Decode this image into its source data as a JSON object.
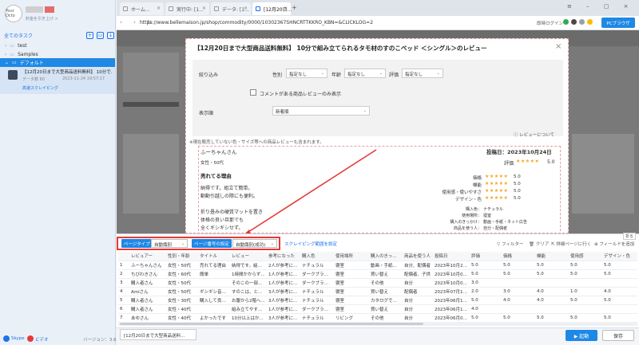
{
  "sidebar": {
    "avatar_text": "Your Octo",
    "plan_text": "料金を引き上げ >",
    "all_tasks": "全てのタスク",
    "tree": [
      {
        "label": "test"
      },
      {
        "label": "Samples"
      },
      {
        "label": "デフォルト"
      }
    ],
    "task": {
      "title": "【12月20日まで大型商品送料無料】 10分で...",
      "meta_label": "データ数",
      "meta_count": "60",
      "meta_date": "2023-11-24 19:57:17",
      "link": "高速スクレイピング"
    },
    "footer": {
      "skype": "Skype",
      "video": "ビデオ",
      "version": "バージョン：3.6.4"
    }
  },
  "tabs": [
    {
      "label": "ホーム..."
    },
    {
      "label": "実行中: [1..."
    },
    {
      "label": "データ: [1..."
    },
    {
      "label": "[12月20日..."
    }
  ],
  "address": {
    "url": "https://www.bellemaison.jp/shop/commodity/0000/10302367SHNCRTTKKRO_KBN=&CLICKLOG=2",
    "login": "即時ログイン",
    "pc_browser": "PCブラウザ"
  },
  "modal": {
    "title": "【12月20日まで大型商品送料無料】 10分で組み立てられるタモ材のすのこベッド ＜シングル＞のレビュー",
    "filter": {
      "narrow_label": "絞り込み",
      "sex_label": "性別",
      "sex_value": "指定なし",
      "age_label": "年齢",
      "age_value": "指定なし",
      "rating_label": "評価",
      "rating_value": "指定なし",
      "comment_only": "コメントがある商品レビューのみ表示",
      "order_label": "表示順",
      "order_value": "新着順"
    },
    "review_about": "ⓘ レビューについて",
    "note": "※現在販売していない色・サイズ等への商品レビューも含まれます。",
    "review": {
      "name": "ふーちゃんさん",
      "post_date": "投稿日：2023年10月24日",
      "attr": "女性・50代",
      "overall_label": "評価",
      "overall_stars": "★★★★★",
      "overall_score": "5.0",
      "reason_title": "売れてる理由",
      "body": [
        "納得です。組立て簡単。",
        "動動引越しの際にも便利。",
        "",
        "折り畳みの硬質マットを置き",
        "体格の良い旦那でも",
        "全くギシギシせず。"
      ],
      "ratings": [
        {
          "label": "価格",
          "stars": "★★★★★",
          "value": "5.0"
        },
        {
          "label": "機能",
          "stars": "★★★★★",
          "value": "5.0"
        },
        {
          "label": "使用感・使いやすさ",
          "stars": "★★★★★",
          "value": "5.0"
        },
        {
          "label": "デザイン・色",
          "stars": "★★★★★",
          "value": "5.0"
        }
      ],
      "attrs": [
        {
          "label": "購入色：",
          "value": "ナチュラル"
        },
        {
          "label": "使用場所：",
          "value": "寝室"
        },
        {
          "label": "購入のきっかけ：",
          "value": "動画・手紙・ネット広告"
        },
        {
          "label": "商品を使う人：",
          "value": "自分・配偶者"
        }
      ]
    }
  },
  "toolbar": {
    "page_type_label": "ページタイプ",
    "page_type_value": "自動識別",
    "page_num_label": "ページ番号の設定",
    "page_num_value": "自動識別(成功)",
    "scroll_settings": "スクレイピング範囲を設定",
    "filter": "フィルター",
    "clear": "クリア",
    "detail_page": "詳細ページに行く",
    "add_field": "フィールドを追加",
    "fold": "折る"
  },
  "table": {
    "headers": [
      "",
      "レビュアー",
      "性別・年齢",
      "タイトル",
      "レビュー",
      "参考になった",
      "購入色",
      "使用場所",
      "購入のきっかけ",
      "商品を使う人",
      "投稿日",
      "評価",
      "価格",
      "機能",
      "使用感",
      "デザイン・色"
    ],
    "rows": [
      [
        "1",
        "ふーちゃんさん",
        "女性・50代",
        "売れてる理由",
        "納得です。組立...",
        "2人が参考になっ...",
        "ナチュラル",
        "寝室",
        "動画・手紙...",
        "自分、配偶者",
        "2023年10月24...",
        "5.0",
        "5.0",
        "5.0",
        "5.0",
        "5.0"
      ],
      [
        "2",
        "ちびわきさん",
        "女性・60代",
        "簡単",
        "1時間かからず...",
        "1人が参考になっ...",
        "ダークブラウン",
        "寝室",
        "買い替え",
        "配偶者、子供",
        "2023年10月07...",
        "5.0",
        "5.0",
        "5.0",
        "5.0",
        "5.0"
      ],
      [
        "3",
        "購入者さん",
        "女性・50代",
        "",
        "そのこの一部に...",
        "1人が参考になっ...",
        "ダークブラウン",
        "寝室",
        "その他",
        "自分",
        "2023年10月04...",
        "3.0",
        "",
        "",
        "",
        ""
      ],
      [
        "4",
        "Amiさん",
        "女性・50代",
        "ギシギシ音が...",
        "すのこは、とて...",
        "3人が参考になっ...",
        "ナチュラル",
        "寝室",
        "買い替え",
        "配偶者",
        "2023年07月12...",
        "2.0",
        "3.0",
        "4.0",
        "1.0",
        "4.0"
      ],
      [
        "5",
        "購入者さん",
        "女性・30代",
        "購入して良かっ...",
        "お腹から2階へ...",
        "3人が参考になっ...",
        "ナチュラル",
        "寝室",
        "カタログで見て",
        "自分",
        "2023年06月17...",
        "5.0",
        "4.0",
        "4.0",
        "5.0",
        "5.0"
      ],
      [
        "6",
        "購入者さん",
        "女性・40代",
        "",
        "組み立てやすく...",
        "1人が参考になっ...",
        "ダークブラウン",
        "寝室",
        "買い替え",
        "自分",
        "2023年06月11...",
        "4.0",
        "",
        "",
        "",
        ""
      ],
      [
        "7",
        "あゆさん",
        "女性・40代",
        "よかったです",
        "10分以上はか...",
        "3人が参考になっ...",
        "ナチュラル",
        "リビング",
        "その他",
        "自分",
        "2023年06月06...",
        "5.0",
        "5.0",
        "5.0",
        "5.0",
        "5.0"
      ]
    ]
  },
  "footer": {
    "task_tab": "[12月20日まで大型商品送料...",
    "start": "▶ 起動",
    "save": "保存"
  }
}
